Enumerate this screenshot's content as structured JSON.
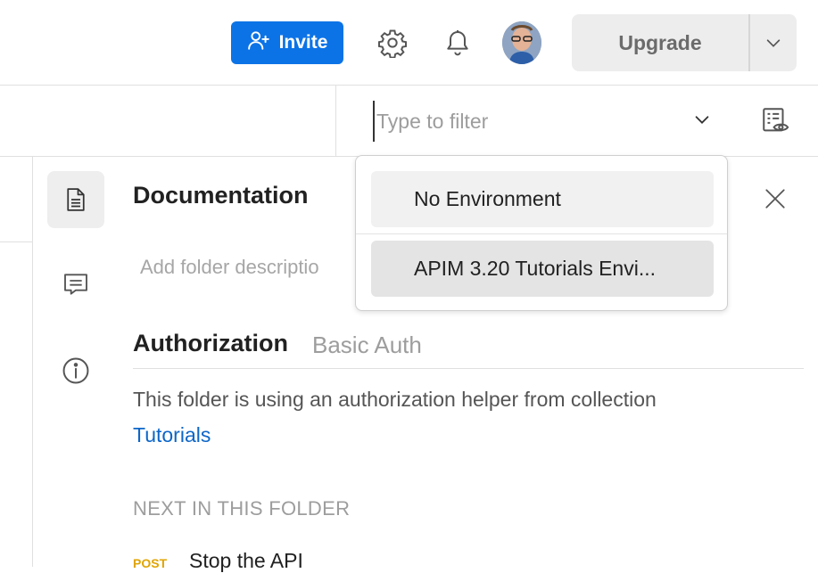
{
  "topbar": {
    "invite_label": "Invite",
    "upgrade_label": "Upgrade",
    "accent": "#0c73e6"
  },
  "filter": {
    "placeholder": "Type to filter"
  },
  "environment_dropdown": {
    "options": [
      {
        "label": "No Environment"
      },
      {
        "label": "APIM 3.20 Tutorials Envi..."
      }
    ]
  },
  "documentation": {
    "title": "Documentation",
    "description_placeholder": "Add folder descriptio"
  },
  "authorization": {
    "title": "Authorization",
    "type": "Basic Auth",
    "helper_text": "This folder is using an authorization helper from collection",
    "link_text": "Tutorials"
  },
  "next_in_folder": {
    "heading": "NEXT IN THIS FOLDER",
    "items": [
      {
        "method": "POST",
        "name": "Stop the API"
      }
    ]
  },
  "icons": {
    "invite": "add-user-icon",
    "settings": "gear-icon",
    "notifications": "bell-icon",
    "upgrade_caret": "chevron-down-icon",
    "filter_caret": "chevron-down-icon",
    "environment_quick_look": "eye-icon",
    "documentation": "document-icon",
    "comments": "comment-icon",
    "info": "info-icon",
    "close": "close-icon"
  }
}
